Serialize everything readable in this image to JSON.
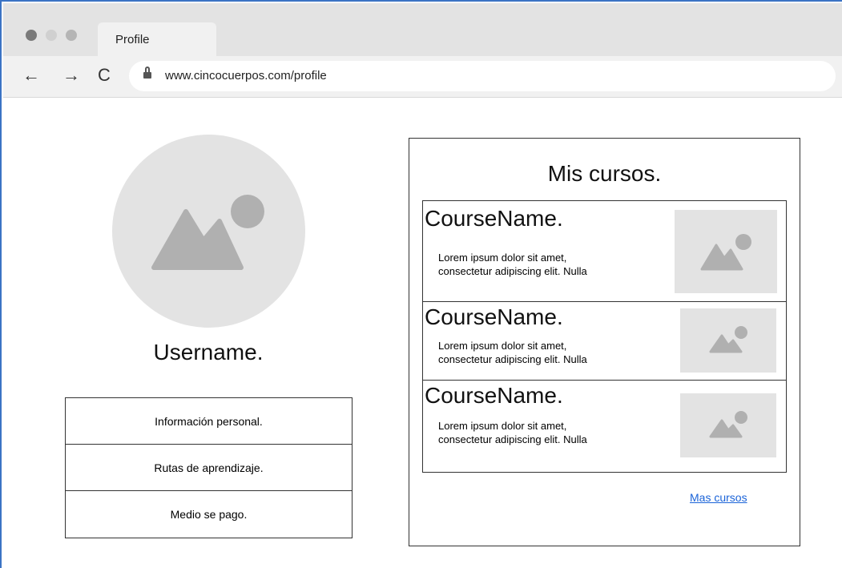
{
  "browser": {
    "tab_title": "Profile",
    "url": "www.cincocuerpos.com/profile",
    "nav": {
      "back": "←",
      "forward": "→",
      "reload": "C"
    }
  },
  "profile": {
    "username": "Username.",
    "menu": [
      {
        "label": "Información personal."
      },
      {
        "label": "Rutas de aprendizaje."
      },
      {
        "label": "Medio se pago."
      }
    ]
  },
  "courses": {
    "title": "Mis cursos.",
    "items": [
      {
        "name": "CourseName.",
        "desc_line1": "Lorem ipsum dolor sit amet,",
        "desc_line2": "consectetur adipiscing elit. Nulla"
      },
      {
        "name": "CourseName.",
        "desc_line1": "Lorem ipsum dolor sit amet,",
        "desc_line2": "consectetur adipiscing elit. Nulla"
      },
      {
        "name": "CourseName.",
        "desc_line1": "Lorem ipsum dolor sit amet,",
        "desc_line2": "consectetur adipiscing elit. Nulla"
      }
    ],
    "more_link": "Mas cursos"
  },
  "colors": {
    "placeholder_bg": "#e3e3e3",
    "placeholder_icon": "#b0b0b0",
    "link": "#1a63d8"
  }
}
